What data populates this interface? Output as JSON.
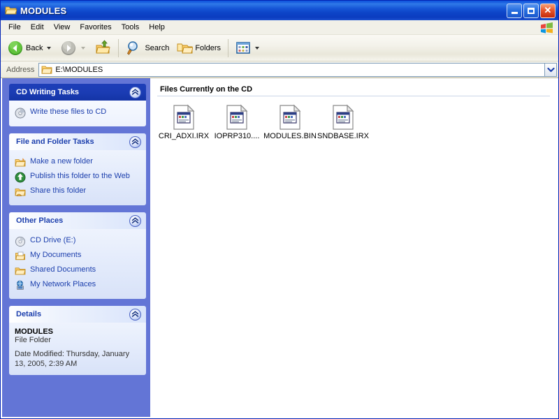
{
  "window": {
    "title": "MODULES",
    "title_icon": "folder-open-icon",
    "minimize_label": "Minimize",
    "maximize_label": "Maximize",
    "close_label": "Close"
  },
  "menubar": {
    "items": [
      {
        "label": "File"
      },
      {
        "label": "Edit"
      },
      {
        "label": "View"
      },
      {
        "label": "Favorites"
      },
      {
        "label": "Tools"
      },
      {
        "label": "Help"
      }
    ],
    "branding_icon": "windows-flag-icon"
  },
  "toolbar": {
    "back_label": "Back",
    "back_icon": "back-arrow-icon",
    "forward_icon": "forward-arrow-icon",
    "up_icon": "up-folder-icon",
    "search_label": "Search",
    "search_icon": "magnifier-icon",
    "folders_label": "Folders",
    "folders_icon": "folders-icon",
    "views_icon": "views-grid-icon"
  },
  "address": {
    "label": "Address",
    "value": "E:\\MODULES",
    "icon": "folder-icon",
    "dropdown_icon": "chevron-down-icon"
  },
  "sidebar": {
    "panels": [
      {
        "title": "CD Writing Tasks",
        "style": "special",
        "collapse_icon": "chevron-up-icon",
        "tasks": [
          {
            "label": "Write these files to CD",
            "icon": "cd-burn-icon"
          }
        ]
      },
      {
        "title": "File and Folder Tasks",
        "style": "normal",
        "collapse_icon": "chevron-up-icon",
        "tasks": [
          {
            "label": "Make a new folder",
            "icon": "new-folder-icon"
          },
          {
            "label": "Publish this folder to the Web",
            "icon": "publish-web-icon"
          },
          {
            "label": "Share this folder",
            "icon": "share-folder-icon"
          }
        ]
      },
      {
        "title": "Other Places",
        "style": "normal",
        "collapse_icon": "chevron-up-icon",
        "tasks": [
          {
            "label": "CD Drive (E:)",
            "icon": "cd-drive-icon"
          },
          {
            "label": "My Documents",
            "icon": "my-documents-icon"
          },
          {
            "label": "Shared Documents",
            "icon": "shared-documents-icon"
          },
          {
            "label": "My Network Places",
            "icon": "network-places-icon"
          }
        ]
      }
    ],
    "details": {
      "title": "Details",
      "collapse_icon": "chevron-up-icon",
      "name": "MODULES",
      "type": "File Folder",
      "date_modified": "Date Modified: Thursday, January 13, 2005, 2:39 AM"
    }
  },
  "filepane": {
    "group_header": "Files Currently on the CD",
    "files": [
      {
        "name": "CRI_ADXI.IRX",
        "icon": "unknown-file-icon"
      },
      {
        "name": "IOPRP310....",
        "icon": "unknown-file-icon"
      },
      {
        "name": "MODULES.BIN",
        "icon": "unknown-file-icon"
      },
      {
        "name": "SNDBASE.IRX",
        "icon": "unknown-file-icon"
      }
    ]
  },
  "colors": {
    "title_blue": "#0f57dd",
    "sidebar_blue": "#6375d6",
    "panel_header_blue": "#1b3cb4",
    "link_blue": "#1c3fad",
    "desktop_blue": "#0831d9"
  }
}
